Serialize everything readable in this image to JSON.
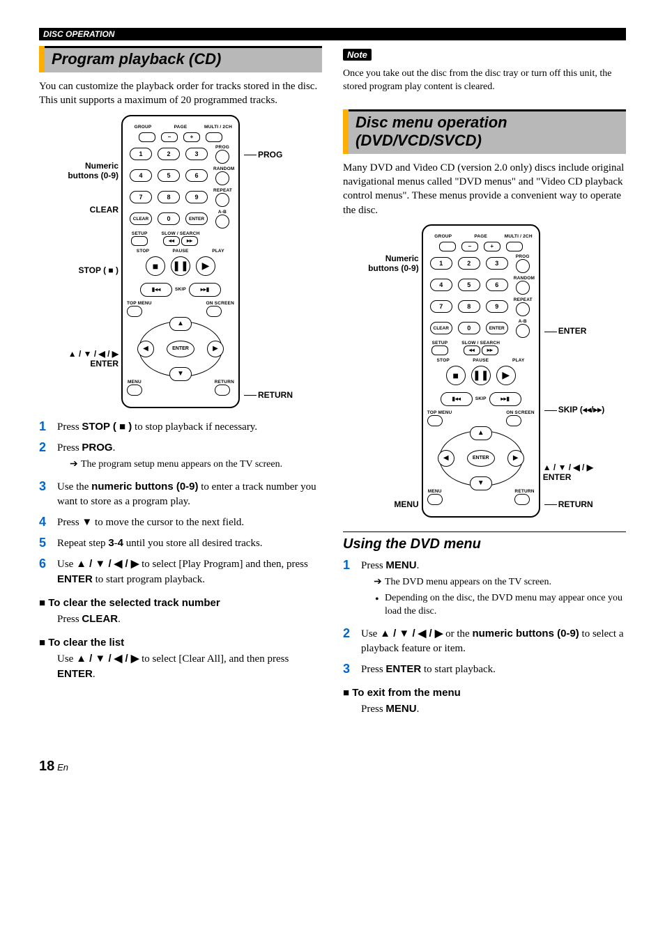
{
  "header": {
    "section": "DISC OPERATION"
  },
  "left": {
    "title": "Program playback (CD)",
    "intro": "You can customize the playback order for tracks stored in the disc. This unit supports a maximum of 20 programmed tracks.",
    "remote": {
      "labels_left": {
        "numeric": "Numeric\nbuttons (0-9)",
        "clear": "CLEAR",
        "stop": "STOP ( ■ )",
        "dpad": "▲ / ▼ / ◀ / ▶\nENTER"
      },
      "labels_right": {
        "prog": "PROG",
        "return": "RETURN"
      },
      "top_tiny": {
        "group": "GROUP",
        "page": "PAGE",
        "multi": "MULTI / 2CH"
      },
      "side_tiny": {
        "prog": "PROG",
        "random": "RANDOM",
        "repeat": "REPEAT",
        "ab": "A-B"
      },
      "row2_tiny": {
        "setup": "SETUP",
        "slow": "SLOW / SEARCH"
      },
      "row3_tiny": {
        "stop": "STOP",
        "pause": "PAUSE",
        "play": "PLAY"
      },
      "row4_tiny": {
        "skip": "SKIP",
        "topmenu": "TOP MENU",
        "onscreen": "ON SCREEN",
        "menu": "MENU",
        "return": "RETURN"
      },
      "clear_btn": "CLEAR",
      "enter_small": "ENTER",
      "enter_center": "ENTER",
      "minus": "−",
      "plus": "+"
    },
    "steps": {
      "1": {
        "a": "Press ",
        "b": "STOP ( ■ )",
        "c": " to stop playback if necessary."
      },
      "2": {
        "a": "Press ",
        "b": "PROG",
        "c": ".",
        "sub1": "The program setup menu appears on the TV screen."
      },
      "3": {
        "a": "Use the ",
        "b": "numeric buttons (0-9)",
        "c": " to enter a track number you want to store as a program play."
      },
      "4": {
        "a": "Press ",
        "glyph": "▼",
        "c": " to move the cursor to the next field."
      },
      "5": {
        "a": "Repeat step ",
        "b1": "3",
        "dash": "-",
        "b2": "4",
        "c": " until you store all desired tracks."
      },
      "6": {
        "a": "Use ",
        "glyph": "▲ / ▼ / ◀ / ▶",
        "b": " to select [Play Program] and then, press ",
        "c": "ENTER",
        "d": " to start program playback."
      }
    },
    "clear_track": {
      "title": "To clear the selected track number",
      "a": "Press ",
      "b": "CLEAR",
      "c": "."
    },
    "clear_list": {
      "title": "To clear the list",
      "a": "Use ",
      "glyph": "▲ / ▼ / ◀ / ▶",
      "b": " to select [Clear All], and then press ",
      "c": "ENTER",
      "d": "."
    }
  },
  "right": {
    "note_label": "Note",
    "note_body": "Once you take out the disc from the disc tray or turn off this unit, the stored program play content is cleared.",
    "title": "Disc menu operation (DVD/VCD/SVCD)",
    "intro": "Many DVD and Video CD (version 2.0 only) discs include original navigational menus called \"DVD menus\" and \"Video CD playback control menus\". These menus provide a convenient way to operate the disc.",
    "remote": {
      "labels_left": {
        "numeric": "Numeric\nbuttons (0-9)",
        "menu": "MENU"
      },
      "labels_right": {
        "enter": "ENTER",
        "skip": "SKIP (◂◂/▸▸)",
        "dpad": "▲ / ▼ / ◀ / ▶\nENTER",
        "return": "RETURN"
      },
      "top_tiny": {
        "group": "GROUP",
        "page": "PAGE",
        "multi": "MULTI / 2CH"
      },
      "side_tiny": {
        "prog": "PROG",
        "random": "RANDOM",
        "repeat": "REPEAT",
        "ab": "A-B"
      },
      "row2_tiny": {
        "setup": "SETUP",
        "slow": "SLOW / SEARCH"
      },
      "row3_tiny": {
        "stop": "STOP",
        "pause": "PAUSE",
        "play": "PLAY"
      },
      "row4_tiny": {
        "skip": "SKIP",
        "topmenu": "TOP MENU",
        "onscreen": "ON SCREEN",
        "menu": "MENU",
        "return": "RETURN"
      },
      "clear_btn": "CLEAR",
      "enter_small": "ENTER",
      "enter_center": "ENTER",
      "minus": "−",
      "plus": "+"
    },
    "subsection": "Using the DVD menu",
    "steps": {
      "1": {
        "a": "Press ",
        "b": "MENU",
        "c": ".",
        "sub1": "The DVD menu appears on the TV screen.",
        "sub2": "Depending on the disc, the DVD menu may appear once you load the disc."
      },
      "2": {
        "a": "Use ",
        "glyph": "▲ / ▼ / ◀ / ▶",
        "b": " or the ",
        "c": "numeric buttons (0-9)",
        "d": " to select a playback feature or item."
      },
      "3": {
        "a": "Press ",
        "b": "ENTER",
        "c": " to start playback."
      }
    },
    "exit": {
      "title": "To exit from the menu",
      "a": "Press ",
      "b": "MENU",
      "c": "."
    }
  },
  "footer": {
    "page_num": "18",
    "lang": "En"
  }
}
